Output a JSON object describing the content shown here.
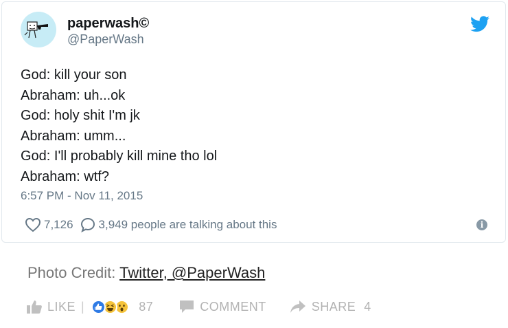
{
  "tweet": {
    "display_name": "paperwash©",
    "handle": "@PaperWash",
    "lines": [
      "God: kill your son",
      "Abraham: uh...ok",
      "God: holy shit I'm jk",
      "Abraham: umm...",
      "God: I'll probably kill mine tho lol",
      "Abraham: wtf?"
    ],
    "timestamp": "6:57 PM - Nov 11, 2015",
    "likes": "7,126",
    "talking": "3,949 people are talking about this"
  },
  "credit": {
    "prefix": "Photo Credit:",
    "link": "Twitter, @PaperWash"
  },
  "actions": {
    "like_label": "LIKE",
    "reaction_count": "87",
    "comment_label": "COMMENT",
    "share_label": "SHARE",
    "share_count": "4"
  },
  "colors": {
    "twitter_blue": "#1da1f2",
    "muted_gray": "#657786",
    "reaction_blue": "#2f7be5",
    "reaction_yellow": "#f5c33b"
  }
}
